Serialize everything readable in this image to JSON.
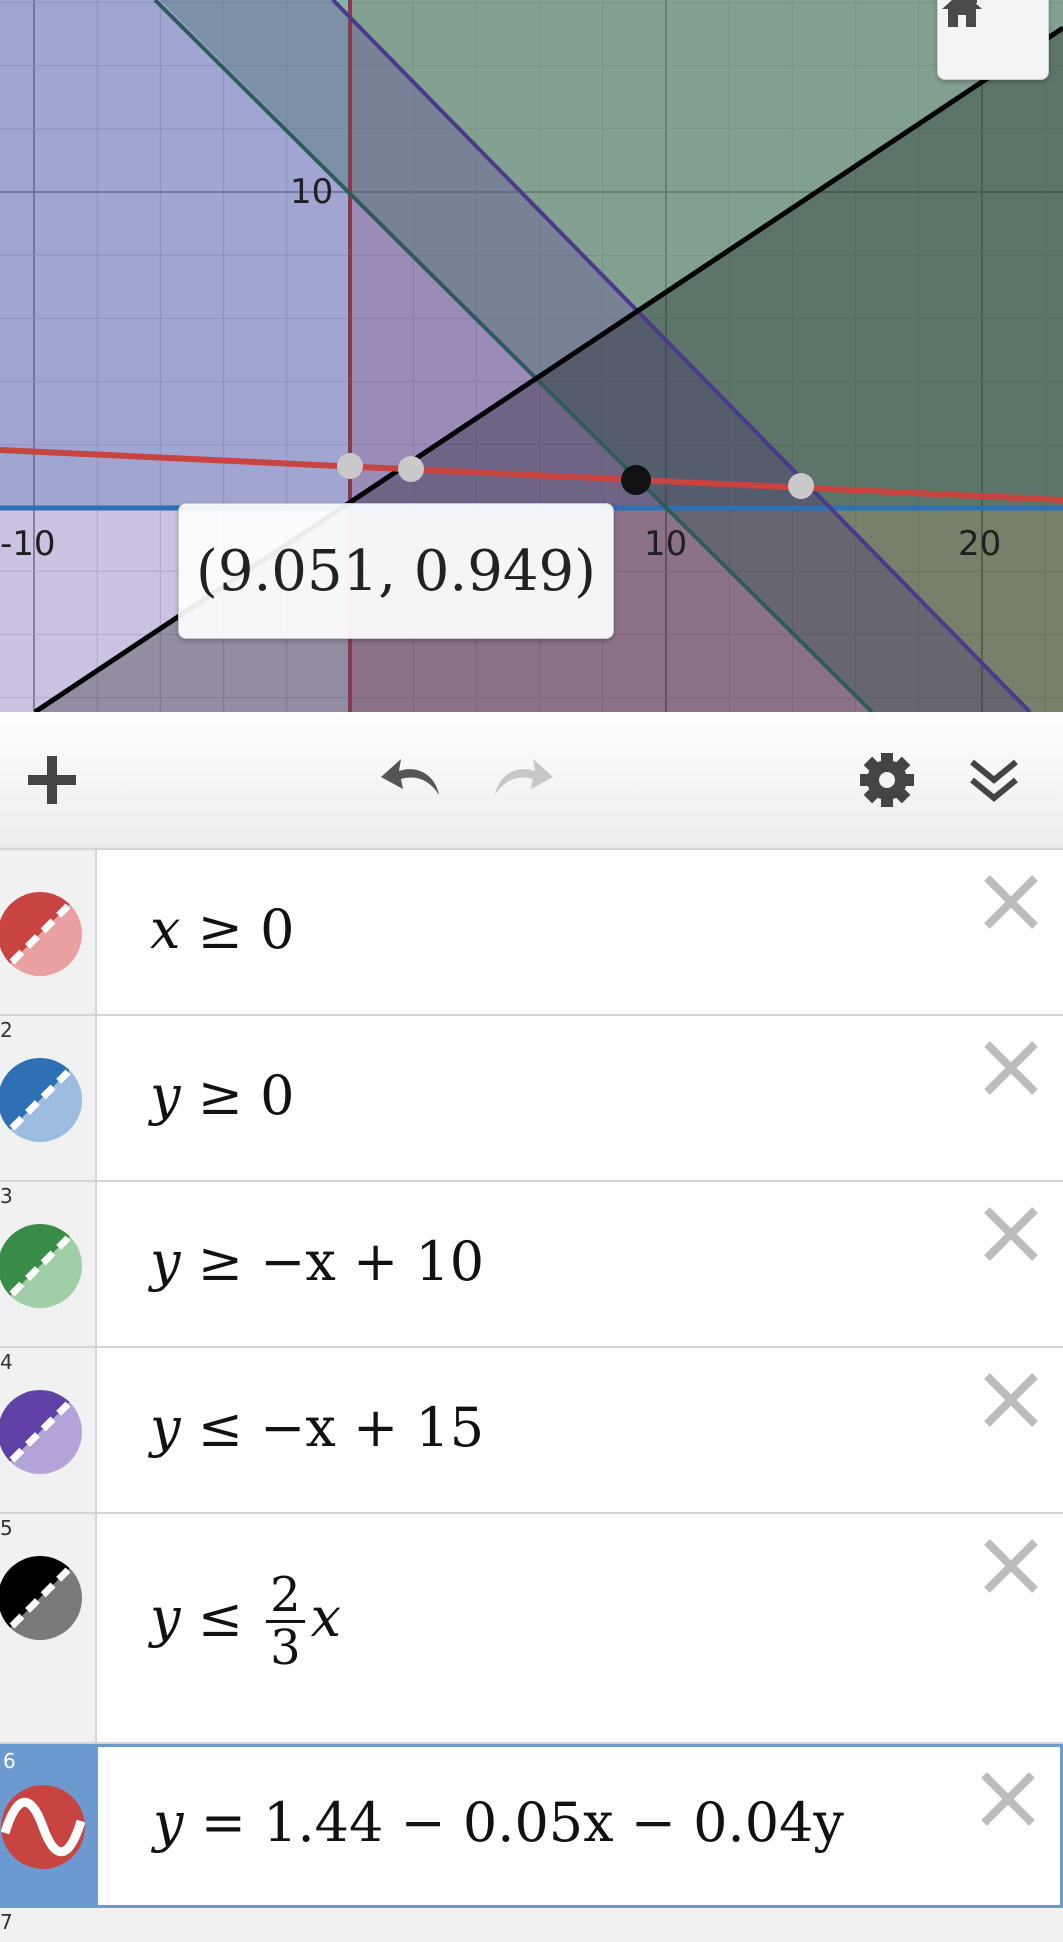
{
  "graph": {
    "x_ticks": [
      "-10",
      "10",
      "20"
    ],
    "y_ticks": [
      "10"
    ],
    "point_label": "(9.051, 0.949)",
    "home_icon": "home-icon",
    "colors": {
      "x_region": "#c74440",
      "y_region": "#2d70b3",
      "green_region": "#388c46",
      "purple_region": "#6042a6",
      "black_line": "#000000",
      "red_curve": "#c74440"
    }
  },
  "toolbar": {
    "add_icon": "plus-icon",
    "undo_icon": "undo-icon",
    "redo_icon": "redo-icon",
    "settings_icon": "gear-icon",
    "collapse_icon": "double-chevron-down-icon"
  },
  "expressions": [
    {
      "num": "",
      "color": "#c74440",
      "type": "inequality",
      "lhs": "x",
      "op": "≥",
      "rhs": "0"
    },
    {
      "num": "2",
      "color": "#2d70b3",
      "type": "inequality",
      "lhs": "y",
      "op": "≥",
      "rhs": "0"
    },
    {
      "num": "3",
      "color": "#388c46",
      "type": "inequality",
      "lhs": "y",
      "op": "≥",
      "rhs": "−x + 10"
    },
    {
      "num": "4",
      "color": "#6042a6",
      "type": "inequality",
      "lhs": "y",
      "op": "≤",
      "rhs": "−x + 15"
    },
    {
      "num": "5",
      "color": "#000000",
      "type": "inequality",
      "lhs": "y",
      "op": "≤",
      "frac_num": "2",
      "frac_den": "3",
      "rhs_after": "x"
    },
    {
      "num": "6",
      "color": "#c74440",
      "type": "curve",
      "lhs": "y",
      "op": "=",
      "rhs": "1.44 − 0.05x − 0.04y"
    }
  ],
  "next_num": "7"
}
